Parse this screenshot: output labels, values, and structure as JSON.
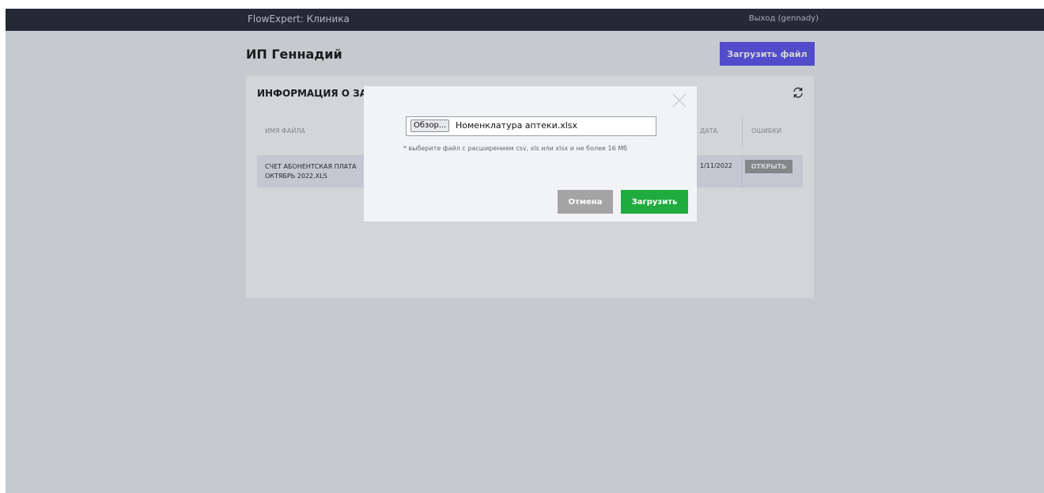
{
  "topbar": {
    "brand": "FlowExpert: Клиника",
    "logout": "Выход (gennady)"
  },
  "page": {
    "title": "ИП Геннадий",
    "upload_button": "Загрузить файл"
  },
  "card": {
    "title": "ИНФОРМАЦИЯ О ЗАГ",
    "columns": {
      "name": "Имя файла",
      "date": "Дата",
      "errors": "Ошибки"
    },
    "rows": [
      {
        "file_name": "СЧЕТ АБОНЕНТСКАЯ ПЛАТА ОКТЯБРЬ 2022.XLS",
        "date": "1/11/2022",
        "errors_button": "ОТКРЫТЬ"
      }
    ]
  },
  "modal": {
    "browse_label": "Обзор...",
    "file_name": "Номенклатура аптеки.xlsx",
    "hint": "* выберите файл с расширением csv, xls или xlsx и не более 16 Мб",
    "cancel_label": "Отмена",
    "submit_label": "Загрузить"
  },
  "icons": {
    "refresh": "refresh-icon",
    "close": "close-icon"
  },
  "colors": {
    "topbar": "#1f2330",
    "primary": "#5a4ff0",
    "success": "#1fab3e",
    "muted": "#a4a4a4"
  }
}
